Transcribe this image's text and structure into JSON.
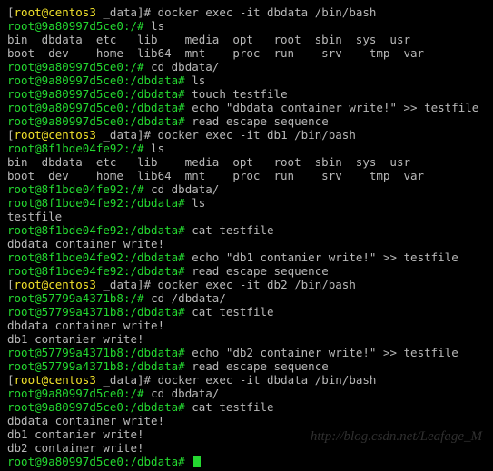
{
  "host_user": "root",
  "host_name": "centos3",
  "host_dir": "_data",
  "container_dbdata": "9a80997d5ce0",
  "container_db1": "8f1bde04fe92",
  "container_db2": "57799a4371b8",
  "dbdata_subdir": "/dbdata",
  "term": {
    "l1_cmd": "docker exec -it dbdata /bin/bash",
    "l2_cmd": "ls",
    "ls_row1": "bin  dbdata  etc   lib    media  opt   root  sbin  sys  usr",
    "ls_row2": "boot  dev    home  lib64  mnt    proc  run    srv    tmp  var",
    "l5_cmd": "cd dbdata/",
    "l6_cmd": "ls",
    "l7_cmd": "touch testfile",
    "l8_cmd": "echo \"dbdata container write!\" >> testfile",
    "l9_cmd": "read escape sequence",
    "l10_cmd": "docker exec -it db1 /bin/bash",
    "l11_cmd": "ls",
    "l14_cmd": "cd dbdata/",
    "l15_cmd": "ls",
    "ls_testfile": "testfile",
    "l17_cmd": "cat testfile",
    "msg_dbdata": "dbdata container write!",
    "l19_cmd": "echo \"db1 contanier write!\" >> testfile",
    "l20_cmd": "read escape sequence",
    "l21_cmd": "docker exec -it db2 /bin/bash",
    "l22_cmd": "cd /dbdata/",
    "l23_cmd": "cat testfile",
    "msg_db1": "db1 contanier write!",
    "l26_cmd": "echo \"db2 container write!\" >> testfile",
    "l27_cmd": "read escape sequence",
    "l28_cmd": "docker exec -it dbdata /bin/bash",
    "l29_cmd": "cd dbdata/",
    "l30_cmd": "cat testfile",
    "msg_db2": "db2 container write!",
    "l34_cmd": ""
  },
  "watermark": "http://blog.csdn.net/Leafage_M"
}
